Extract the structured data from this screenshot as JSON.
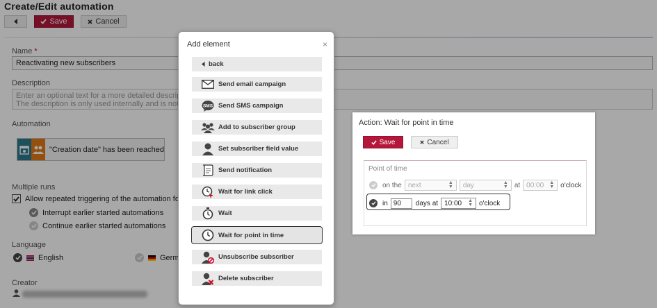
{
  "page": {
    "title": "Create/Edit automation",
    "toolbar": {
      "save_label": "Save",
      "cancel_label": "Cancel"
    },
    "name": {
      "label": "Name",
      "required_mark": "*",
      "value": "Reactivating new subscribers"
    },
    "description": {
      "label": "Description",
      "placeholder_line1": "Enter an optional text for a more detailed description",
      "placeholder_line2": "The description is only used internally and is not visi"
    },
    "automation": {
      "label": "Automation",
      "trigger_text": "\"Creation date\" has been reached"
    },
    "multiple_runs": {
      "label": "Multiple runs",
      "allow_label": "Allow repeated triggering of the automation for ea",
      "interrupt_label": "Interrupt earlier started automations",
      "continue_label": "Continue earlier started automations"
    },
    "language": {
      "label": "Language",
      "english": "English",
      "german": "Germa"
    },
    "creator": {
      "label": "Creator"
    }
  },
  "modal": {
    "title": "Add element",
    "close": "×",
    "back_label": "back",
    "items": [
      {
        "label": "Send email campaign",
        "icon": "envelope-icon"
      },
      {
        "label": "Send SMS campaign",
        "icon": "sms-icon"
      },
      {
        "label": "Add to subscriber group",
        "icon": "group-icon"
      },
      {
        "label": "Set subscriber field value",
        "icon": "user-icon"
      },
      {
        "label": "Send notification",
        "icon": "notification-icon"
      },
      {
        "label": "Wait for link click",
        "icon": "clock-cursor-icon"
      },
      {
        "label": "Wait",
        "icon": "stopwatch-icon"
      },
      {
        "label": "Wait for point in time",
        "icon": "clock-icon"
      },
      {
        "label": "Unsubscribe subscriber",
        "icon": "user-unsubscribe-icon"
      },
      {
        "label": "Delete subscriber",
        "icon": "user-delete-icon"
      }
    ]
  },
  "action": {
    "title": "Action: Wait for point in time",
    "save_label": "Save",
    "cancel_label": "Cancel",
    "section_label": "Point of time",
    "row1": {
      "on_the": "on the",
      "next": "next",
      "day": "day",
      "at": "at",
      "time": "00:00",
      "oclock": "o'clock"
    },
    "row2": {
      "in": "in",
      "days": "90",
      "days_at": "days at",
      "time": "10:00",
      "oclock": "o'clock"
    }
  },
  "colors": {
    "primary": "#b5173b",
    "overlay": "rgba(0,0,0,0.34)"
  }
}
